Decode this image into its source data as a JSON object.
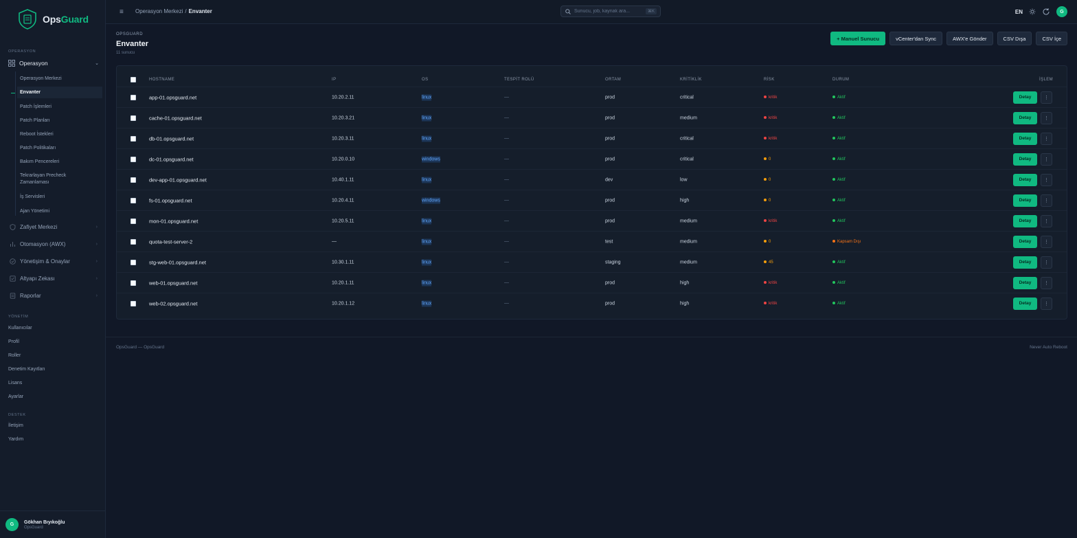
{
  "brand": {
    "name_part1": "Ops",
    "name_part2": "Guard"
  },
  "sidebar": {
    "section_ops": "OPERASYON",
    "operasyon": {
      "label": "Operasyon",
      "items": [
        {
          "label": "Operasyon Merkezi"
        },
        {
          "label": "Envanter",
          "active": true
        },
        {
          "label": "Patch İşlemleri"
        },
        {
          "label": "Patch Planları"
        },
        {
          "label": "Reboot İstekleri"
        },
        {
          "label": "Patch Politikaları"
        },
        {
          "label": "Bakım Pencereleri"
        },
        {
          "label": "Tekrarlayan Precheck Zamanlaması"
        },
        {
          "label": "İş Servisleri"
        },
        {
          "label": "Ajan Yönetimi"
        }
      ]
    },
    "groups": [
      {
        "label": "Zafiyet Merkezi"
      },
      {
        "label": "Otomasyon (AWX)"
      },
      {
        "label": "Yönetişim & Onaylar"
      },
      {
        "label": "Altyapı Zekası"
      },
      {
        "label": "Raporlar"
      }
    ],
    "section_mgmt": "YÖNETİM",
    "mgmt_items": [
      {
        "label": "Kullanıcılar"
      },
      {
        "label": "Profil"
      },
      {
        "label": "Roller"
      },
      {
        "label": "Denetim Kayıtları"
      },
      {
        "label": "Lisans"
      },
      {
        "label": "Ayarlar"
      }
    ],
    "section_support": "DESTEK",
    "support_items": [
      {
        "label": "İletişim"
      },
      {
        "label": "Yardım"
      }
    ],
    "user": {
      "initial": "G",
      "name": "Gökhan Bıyıkoğlu",
      "org": "OpsGuard"
    }
  },
  "topbar": {
    "breadcrumb_parent": "Operasyon Merkezi",
    "breadcrumb_sep": "/",
    "breadcrumb_current": "Envanter",
    "search_placeholder": "Sunucu, job, kaynak ara...",
    "search_shortcut": "⌘K",
    "lang": "EN",
    "avatar_initial": "G"
  },
  "page": {
    "eyebrow": "OPSGUARD",
    "title": "Envanter",
    "count": "11 sunucu",
    "actions": {
      "add": "+ Manuel Sunucu",
      "vcenter": "vCenter'dan Sync",
      "awx": "AWX'e Gönder",
      "csv_out": "CSV Dışa",
      "csv_in": "CSV İçe"
    }
  },
  "table": {
    "headers": {
      "hostname": "HOSTNAME",
      "ip": "IP",
      "os": "OS",
      "role": "TESPİT ROLÜ",
      "env": "ORTAM",
      "crit": "KRİTİKLİK",
      "risk": "RİSK",
      "status": "DURUM",
      "action": "İŞLEM"
    },
    "detail_label": "Detay",
    "more_label": "⋮",
    "rows": [
      {
        "host": "app-01.opsguard.net",
        "ip": "10.20.2.11",
        "os": "linux",
        "role": "—",
        "env": "prod",
        "crit": "critical",
        "risk": "kritik",
        "risk_level": "red",
        "status": "Aktif",
        "status_level": "green"
      },
      {
        "host": "cache-01.opsguard.net",
        "ip": "10.20.3.21",
        "os": "linux",
        "role": "—",
        "env": "prod",
        "crit": "medium",
        "risk": "kritik",
        "risk_level": "red",
        "status": "Aktif",
        "status_level": "green"
      },
      {
        "host": "db-01.opsguard.net",
        "ip": "10.20.3.11",
        "os": "linux",
        "role": "—",
        "env": "prod",
        "crit": "critical",
        "risk": "kritik",
        "risk_level": "red",
        "status": "Aktif",
        "status_level": "green"
      },
      {
        "host": "dc-01.opsguard.net",
        "ip": "10.20.0.10",
        "os": "windows",
        "role": "—",
        "env": "prod",
        "crit": "critical",
        "risk": "0",
        "risk_level": "amber",
        "status": "Aktif",
        "status_level": "green"
      },
      {
        "host": "dev-app-01.opsguard.net",
        "ip": "10.40.1.11",
        "os": "linux",
        "role": "—",
        "env": "dev",
        "crit": "low",
        "risk": "0",
        "risk_level": "amber",
        "status": "Aktif",
        "status_level": "green"
      },
      {
        "host": "fs-01.opsguard.net",
        "ip": "10.20.4.11",
        "os": "windows",
        "role": "—",
        "env": "prod",
        "crit": "high",
        "risk": "0",
        "risk_level": "amber",
        "status": "Aktif",
        "status_level": "green"
      },
      {
        "host": "mon-01.opsguard.net",
        "ip": "10.20.5.11",
        "os": "linux",
        "role": "—",
        "env": "prod",
        "crit": "medium",
        "risk": "kritik",
        "risk_level": "red",
        "status": "Aktif",
        "status_level": "green"
      },
      {
        "host": "quota-test-server-2",
        "ip": "—",
        "os": "linux",
        "role": "—",
        "env": "test",
        "crit": "medium",
        "risk": "0",
        "risk_level": "amber",
        "status": "Kapsam Dışı",
        "status_level": "orange"
      },
      {
        "host": "stg-web-01.opsguard.net",
        "ip": "10.30.1.11",
        "os": "linux",
        "role": "—",
        "env": "staging",
        "crit": "medium",
        "risk": "45",
        "risk_level": "amber",
        "status": "Aktif",
        "status_level": "green"
      },
      {
        "host": "web-01.opsguard.net",
        "ip": "10.20.1.11",
        "os": "linux",
        "role": "—",
        "env": "prod",
        "crit": "high",
        "risk": "kritik",
        "risk_level": "red",
        "status": "Aktif",
        "status_level": "green"
      },
      {
        "host": "web-02.opsguard.net",
        "ip": "10.20.1.12",
        "os": "linux",
        "role": "—",
        "env": "prod",
        "crit": "high",
        "risk": "kritik",
        "risk_level": "red",
        "status": "Aktif",
        "status_level": "green"
      }
    ]
  },
  "footer": {
    "left": "OpsGuard — OpsGuard",
    "right": "Never Auto Reboot"
  },
  "colors": {
    "accent": "#10b981",
    "red": "#ef4444",
    "amber": "#f59e0b",
    "green": "#22c55e",
    "orange": "#f97316",
    "link": "#60a5fa"
  }
}
